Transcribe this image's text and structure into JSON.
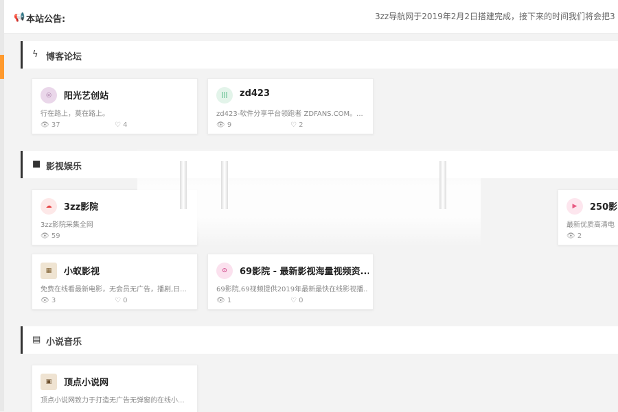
{
  "notice": {
    "icon": "megaphone-icon",
    "label": "本站公告:",
    "text": "3zz导航网于2019年2月2日搭建完成，接下来的时间我们将会把3"
  },
  "sections": [
    {
      "icon": "bolt-icon",
      "title": "博客论坛",
      "cards": [
        {
          "name": "阳光艺创站",
          "desc": "行在路上，莫在路上。",
          "views": "37",
          "likes": "4",
          "logo_color": "#c9a3c8",
          "logo_text": "◎"
        },
        {
          "name": "zd423",
          "desc": "zd423-软件分享平台领跑者 ZDFANS.COM。...",
          "views": "9",
          "likes": "2",
          "logo_color": "#2aa866",
          "logo_text": "|||"
        }
      ]
    },
    {
      "icon": "video-camera-icon",
      "title": "影视娱乐",
      "cards": [
        {
          "name": "3zz影院",
          "desc": "3zz影院采集全网",
          "views": "59",
          "likes": "",
          "logo_color": "#e64646",
          "logo_text": "☁"
        },
        {
          "name": "250影",
          "desc": "最新优质高清电",
          "views": "2",
          "likes": "",
          "logo_color": "#e85a83",
          "logo_text": "▶"
        },
        {
          "name": "小蚁影视",
          "desc": "免费在线看最新电影，无会员无广告，播剧,日...",
          "views": "3",
          "likes": "0",
          "logo_color": "#7a5a2a",
          "logo_text": "▦"
        },
        {
          "name": "69影院 - 最新影视海量视频资...",
          "desc": "69影院,69视频提供2019年最新最快在线影视播...",
          "views": "1",
          "likes": "0",
          "logo_color": "#c4186b",
          "logo_text": "⊙"
        }
      ]
    },
    {
      "icon": "book-icon",
      "title": "小说音乐",
      "cards": [
        {
          "name": "顶点小说网",
          "desc": "顶点小说网致力于打造无广告无弹窗的在线小...",
          "views": "",
          "likes": "",
          "logo_color": "#6b4d2a",
          "logo_text": "▣"
        }
      ]
    }
  ]
}
